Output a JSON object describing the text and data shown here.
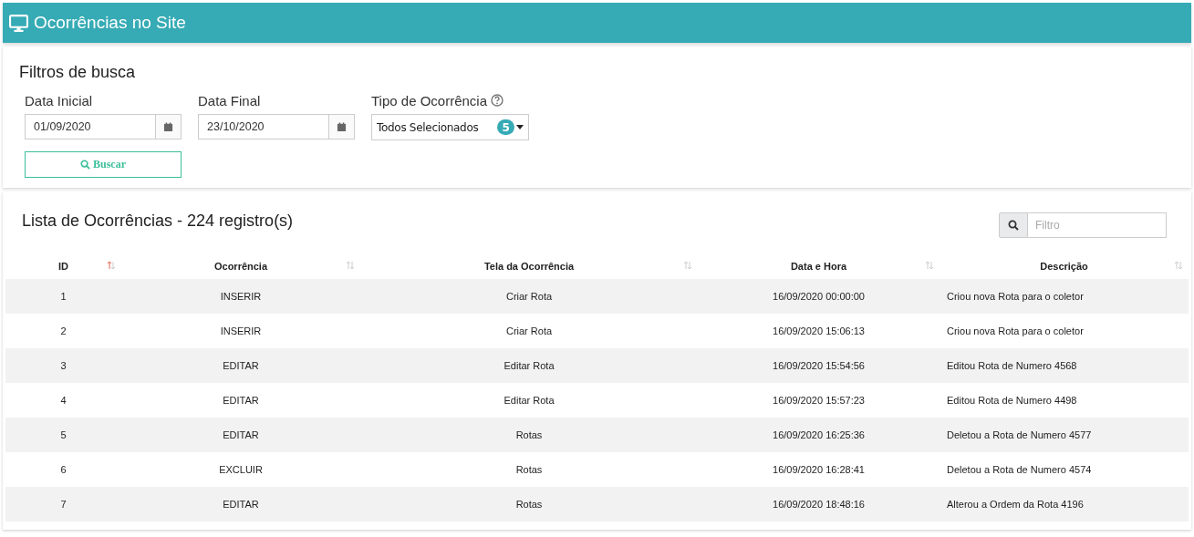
{
  "header": {
    "title": "Ocorrências no Site"
  },
  "filters": {
    "title": "Filtros de busca",
    "start_date": {
      "label": "Data Inicial",
      "value": "01/09/2020"
    },
    "end_date": {
      "label": "Data Final",
      "value": "23/10/2020"
    },
    "type": {
      "label": "Tipo de Ocorrência",
      "value": "Todos Selecionados",
      "count": "5"
    },
    "search_button": "Buscar"
  },
  "list": {
    "title": "Lista de Ocorrências - 224 registro(s)",
    "filter": {
      "placeholder": "Filtro"
    },
    "columns": [
      {
        "label": "ID",
        "sorted": true
      },
      {
        "label": "Ocorrência",
        "sorted": false
      },
      {
        "label": "Tela da Ocorrência",
        "sorted": false
      },
      {
        "label": "Data e Hora",
        "sorted": false
      },
      {
        "label": "Descrição",
        "sorted": false
      }
    ],
    "rows": [
      [
        "1",
        "INSERIR",
        "Criar Rota",
        "16/09/2020 00:00:00",
        "Criou nova Rota para o coletor"
      ],
      [
        "2",
        "INSERIR",
        "Criar Rota",
        "16/09/2020 15:06:13",
        "Criou nova Rota para o coletor"
      ],
      [
        "3",
        "EDITAR",
        "Editar Rota",
        "16/09/2020 15:54:56",
        "Editou Rota de Numero 4568"
      ],
      [
        "4",
        "EDITAR",
        "Editar Rota",
        "16/09/2020 15:57:23",
        "Editou Rota de Numero 4498"
      ],
      [
        "5",
        "EDITAR",
        "Rotas",
        "16/09/2020 16:25:36",
        "Deletou a Rota de Numero 4577"
      ],
      [
        "6",
        "EXCLUIR",
        "Rotas",
        "16/09/2020 16:28:41",
        "Deletou a Rota de Numero 4574"
      ],
      [
        "7",
        "EDITAR",
        "Rotas",
        "16/09/2020 18:48:16",
        "Alterou a Ordem da Rota 4196"
      ]
    ]
  }
}
